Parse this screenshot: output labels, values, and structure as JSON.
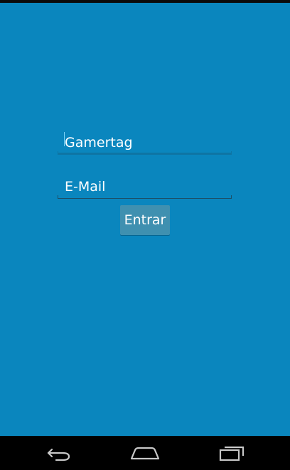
{
  "colors": {
    "background": "#0a86be",
    "button": "#3f90b0",
    "text": "#ffffff",
    "nav_bar": "#000000"
  },
  "form": {
    "gamertag_placeholder": "Gamertag",
    "email_placeholder": "E-Mail",
    "submit_label": "Entrar"
  },
  "nav": {
    "back_icon": "back-arrow-icon",
    "home_icon": "home-icon",
    "recents_icon": "recent-apps-icon"
  }
}
